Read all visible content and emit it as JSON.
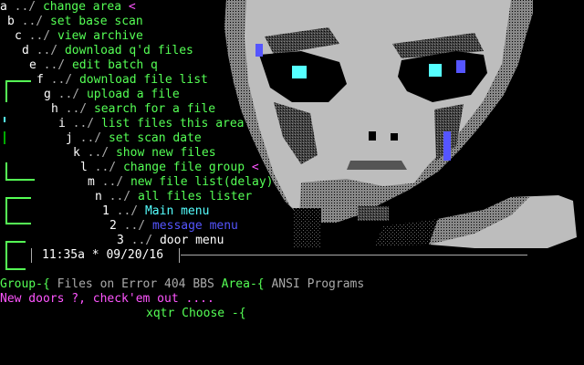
{
  "menu": [
    {
      "key": "a",
      "sep": " ../ ",
      "label": "change area",
      "suffix": " <"
    },
    {
      "key": "b",
      "sep": " ../ ",
      "label": "set base scan",
      "suffix": ""
    },
    {
      "key": "c",
      "sep": " ../ ",
      "label": "view archive",
      "suffix": ""
    },
    {
      "key": "d",
      "sep": " ../ ",
      "label": "download q'd files",
      "suffix": ""
    },
    {
      "key": "e",
      "sep": " ../ ",
      "label": "edit batch q",
      "suffix": ""
    },
    {
      "key": "f",
      "sep": " ../ ",
      "label": "download file list",
      "suffix": ""
    },
    {
      "key": "g",
      "sep": " ../ ",
      "label": "upload a file",
      "suffix": ""
    },
    {
      "key": "h",
      "sep": " ../ ",
      "label": "search for a file",
      "suffix": ""
    },
    {
      "key": "i",
      "sep": " ../ ",
      "label": "list files this area",
      "suffix": ""
    },
    {
      "key": "j",
      "sep": " ../ ",
      "label": "set scan date",
      "suffix": ""
    },
    {
      "key": "k",
      "sep": " ../ ",
      "label": "show new files",
      "suffix": ""
    },
    {
      "key": "l",
      "sep": " ../ ",
      "label": "change file group",
      "suffix": " <"
    },
    {
      "key": "m",
      "sep": " ../ ",
      "label": "new file list(delay)",
      "suffix": ""
    },
    {
      "key": "n",
      "sep": " ../ ",
      "label": "all files lister",
      "suffix": ""
    },
    {
      "key": "1",
      "sep": " ../ ",
      "label": "Main menu",
      "suffix": ""
    },
    {
      "key": "2",
      "sep": " ../ ",
      "label": "message menu",
      "suffix": ""
    },
    {
      "key": "3",
      "sep": " ../ ",
      "label": "door menu",
      "suffix": ""
    }
  ],
  "status": {
    "time": "11:35a",
    "star": "*",
    "date": "09/20/16"
  },
  "footer": {
    "group_line": "Group-{ Files on Error 404 BBS Area-{ ANSI Programs",
    "new_doors": "New doors ?, check'em out ....",
    "prompt": "xqtr Choose -{"
  },
  "colors": {
    "key": "#ffffff",
    "label": "#55ff55",
    "cyan": "#55ffff",
    "blue": "#5555ff",
    "magenta": "#ff55ff",
    "background": "#000000"
  },
  "art": {
    "subject": "alien-face-ansi-art"
  }
}
